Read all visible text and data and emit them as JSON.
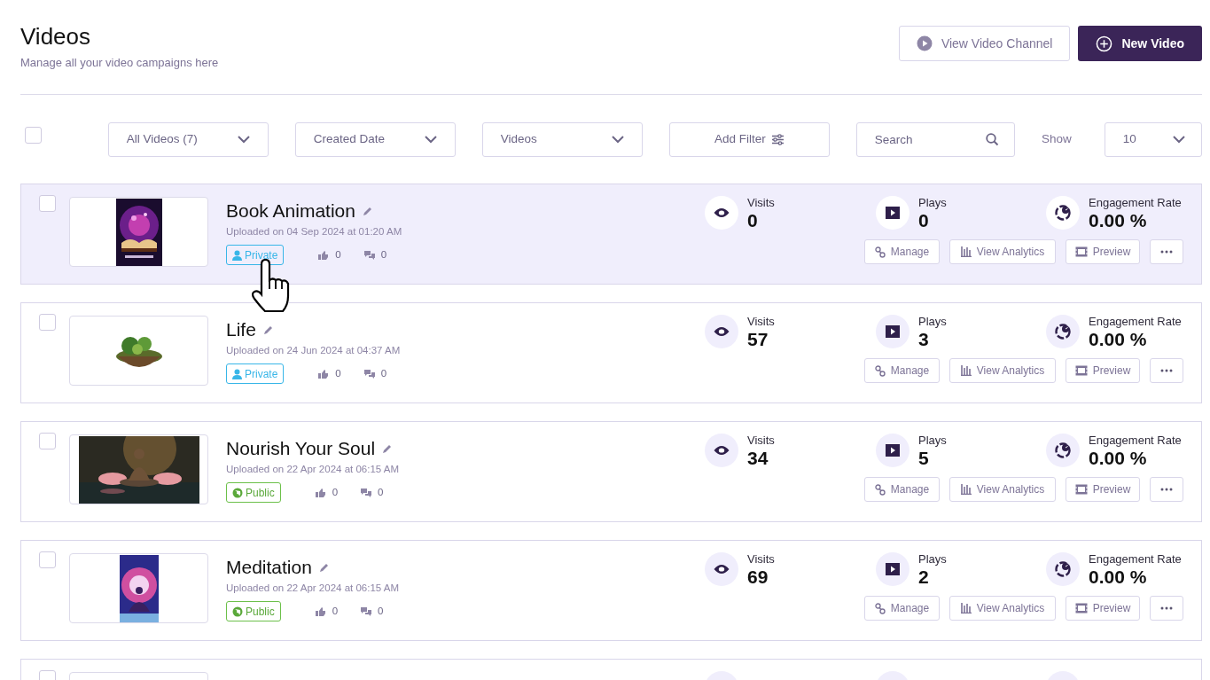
{
  "header": {
    "title": "Videos",
    "subtitle": "Manage all your video campaigns here"
  },
  "actions": [
    {
      "label": "View Video Channel",
      "kind": "secondary"
    },
    {
      "label": "New Video",
      "kind": "primary"
    }
  ],
  "toolbar": {
    "select_all_checked": false,
    "filters": [
      {
        "label": "All Videos (7)",
        "kind": "dropdown"
      },
      {
        "label": "Created Date",
        "kind": "dropdown"
      },
      {
        "label": "Videos",
        "kind": "dropdown"
      },
      {
        "label": "Add Filter",
        "kind": "button"
      }
    ],
    "search": {
      "placeholder": "Search"
    },
    "show_label": "Show",
    "page_size": "10"
  },
  "videos": [
    {
      "title": "Book Animation",
      "uploaded": "Uploaded on 04 Sep 2024 at 01:20 AM",
      "visibility": {
        "label": "Private",
        "kind": "private"
      },
      "likes": "0",
      "comments": "0",
      "selected": true,
      "checked": false,
      "visits_label": "Visits",
      "visits": "0",
      "plays_label": "Plays",
      "plays": "0",
      "engagement_label": "Engagement Rate",
      "engagement": "0.00 %",
      "buttons": [
        "Manage",
        "View Analytics",
        "Preview"
      ]
    },
    {
      "title": "Life",
      "uploaded": "Uploaded on 24 Jun 2024 at 04:37 AM",
      "visibility": {
        "label": "Private",
        "kind": "private"
      },
      "likes": "0",
      "comments": "0",
      "selected": false,
      "checked": false,
      "visits_label": "Visits",
      "visits": "57",
      "plays_label": "Plays",
      "plays": "3",
      "engagement_label": "Engagement Rate",
      "engagement": "0.00 %",
      "buttons": [
        "Manage",
        "View Analytics",
        "Preview"
      ]
    },
    {
      "title": "Nourish Your Soul",
      "uploaded": "Uploaded on 22 Apr 2024 at 06:15 AM",
      "visibility": {
        "label": "Public",
        "kind": "public"
      },
      "likes": "0",
      "comments": "0",
      "selected": false,
      "checked": false,
      "visits_label": "Visits",
      "visits": "34",
      "plays_label": "Plays",
      "plays": "5",
      "engagement_label": "Engagement Rate",
      "engagement": "0.00 %",
      "buttons": [
        "Manage",
        "View Analytics",
        "Preview"
      ]
    },
    {
      "title": "Meditation",
      "uploaded": "Uploaded on 22 Apr 2024 at 06:15 AM",
      "visibility": {
        "label": "Public",
        "kind": "public"
      },
      "likes": "0",
      "comments": "0",
      "selected": false,
      "checked": false,
      "visits_label": "Visits",
      "visits": "69",
      "plays_label": "Plays",
      "plays": "2",
      "engagement_label": "Engagement Rate",
      "engagement": "0.00 %",
      "buttons": [
        "Manage",
        "View Analytics",
        "Preview"
      ]
    },
    {
      "selected": false,
      "checked": false
    }
  ]
}
